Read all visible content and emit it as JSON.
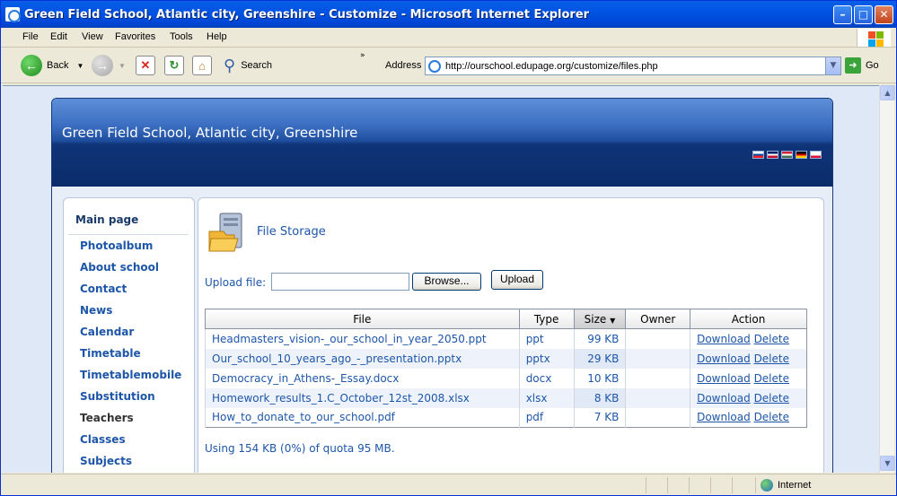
{
  "window": {
    "title": "Green Field School, Atlantic city, Greenshire - Customize - Microsoft Internet Explorer"
  },
  "menu": [
    "File",
    "Edit",
    "View",
    "Favorites",
    "Tools",
    "Help"
  ],
  "toolbar": {
    "back_label": "Back",
    "search_label": "Search",
    "address_label": "Address",
    "url": "http://ourschool.edupage.org/customize/files.php",
    "go_label": "Go"
  },
  "site": {
    "title": "Green Field School, Atlantic city, Greenshire",
    "flags": [
      {
        "name": "flag-slovakia",
        "colors": [
          "#ffffff",
          "#0b4ea2",
          "#ee1c25"
        ]
      },
      {
        "name": "flag-uk",
        "colors": [
          "#012169",
          "#ffffff",
          "#c8102e"
        ]
      },
      {
        "name": "flag-hungary",
        "colors": [
          "#ce2939",
          "#ffffff",
          "#477050"
        ]
      },
      {
        "name": "flag-germany",
        "colors": [
          "#000000",
          "#dd0000",
          "#ffce00"
        ]
      },
      {
        "name": "flag-poland",
        "colors": [
          "#ffffff",
          "#ffffff",
          "#dc143c"
        ]
      }
    ]
  },
  "sidebar": {
    "main_page": "Main page",
    "items": [
      {
        "label": "Photoalbum",
        "name": "sidebar-item-photoalbum",
        "dark": false
      },
      {
        "label": "About school",
        "name": "sidebar-item-about-school",
        "dark": false
      },
      {
        "label": "Contact",
        "name": "sidebar-item-contact",
        "dark": false
      },
      {
        "label": "News",
        "name": "sidebar-item-news",
        "dark": false
      },
      {
        "label": "Calendar",
        "name": "sidebar-item-calendar",
        "dark": false
      },
      {
        "label": "Timetable",
        "name": "sidebar-item-timetable",
        "dark": false
      },
      {
        "label": "Timetablemobile",
        "name": "sidebar-item-timetablemobile",
        "dark": false
      },
      {
        "label": "Substitution",
        "name": "sidebar-item-substitution",
        "dark": false
      },
      {
        "label": "Teachers",
        "name": "sidebar-item-teachers",
        "dark": true
      },
      {
        "label": "Classes",
        "name": "sidebar-item-classes",
        "dark": false
      },
      {
        "label": "Subjects",
        "name": "sidebar-item-subjects",
        "dark": false
      }
    ]
  },
  "main": {
    "title": "File Storage",
    "upload_label": "Upload file:",
    "browse_label": "Browse...",
    "upload_button": "Upload",
    "columns": [
      "File",
      "Type",
      "Size",
      "Owner",
      "Action"
    ],
    "files": [
      {
        "name": "Headmasters_vision-_our_school_in_year_2050.ppt",
        "type": "ppt",
        "size": "99 KB",
        "owner": ""
      },
      {
        "name": "Our_school_10_years_ago_-_presentation.pptx",
        "type": "pptx",
        "size": "29 KB",
        "owner": ""
      },
      {
        "name": "Democracy_in_Athens-_Essay.docx",
        "type": "docx",
        "size": "10 KB",
        "owner": ""
      },
      {
        "name": "Homework_results_1.C_October_12st_2008.xlsx",
        "type": "xlsx",
        "size": "8 KB",
        "owner": ""
      },
      {
        "name": "How_to_donate_to_our_school.pdf",
        "type": "pdf",
        "size": "7 KB",
        "owner": ""
      }
    ],
    "download_label": "Download",
    "delete_label": "Delete",
    "quota": "Using 154 KB (0%) of quota 95 MB."
  },
  "status": {
    "zone": "Internet"
  }
}
